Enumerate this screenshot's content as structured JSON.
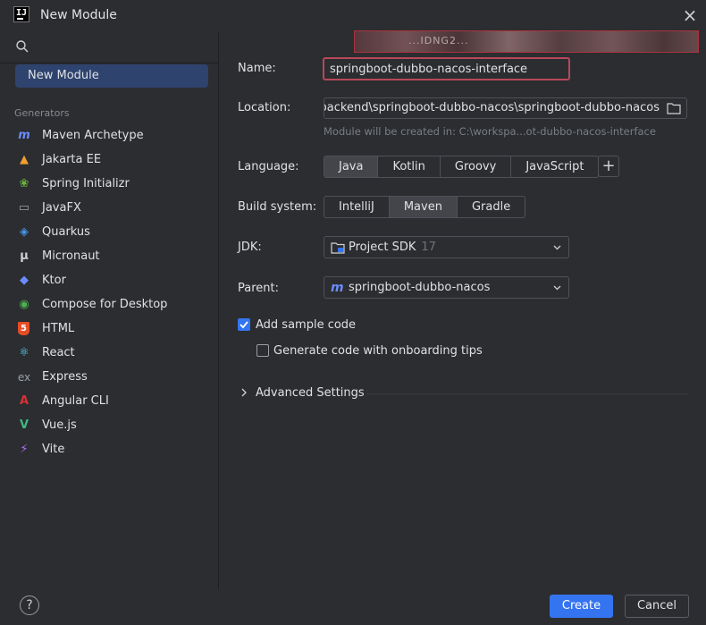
{
  "window": {
    "title": "New Module"
  },
  "sidebar": {
    "search_placeholder": "",
    "selected": "New Module",
    "group_label": "Generators",
    "generators": [
      {
        "label": "Maven Archetype",
        "icon": "maven-icon",
        "color": "#6b8cff"
      },
      {
        "label": "Jakarta EE",
        "icon": "jakarta-icon",
        "color": "#f0a030"
      },
      {
        "label": "Spring Initializr",
        "icon": "spring-icon",
        "color": "#6cb33f"
      },
      {
        "label": "JavaFX",
        "icon": "javafx-icon",
        "color": "#9aa0a6"
      },
      {
        "label": "Quarkus",
        "icon": "quarkus-icon",
        "color": "#4695eb"
      },
      {
        "label": "Micronaut",
        "icon": "micronaut-icon",
        "color": "#cfd1d4"
      },
      {
        "label": "Ktor",
        "icon": "ktor-icon",
        "color": "#6b8cff"
      },
      {
        "label": "Compose for Desktop",
        "icon": "compose-icon",
        "color": "#4caf50"
      },
      {
        "label": "HTML",
        "icon": "html-icon",
        "color": "#e44d26"
      },
      {
        "label": "React",
        "icon": "react-icon",
        "color": "#61dafb"
      },
      {
        "label": "Express",
        "icon": "express-icon",
        "color": "#9aa0a6"
      },
      {
        "label": "Angular CLI",
        "icon": "angular-icon",
        "color": "#dd3035"
      },
      {
        "label": "Vue.js",
        "icon": "vue-icon",
        "color": "#41b883"
      },
      {
        "label": "Vite",
        "icon": "vite-icon",
        "color": "#b46cff"
      }
    ]
  },
  "form": {
    "name_label": "Name:",
    "name_value": "springboot-dubbo-nacos-interface",
    "location_label": "Location:",
    "location_value": "backend\\springboot-dubbo-nacos\\springboot-dubbo-nacos",
    "location_hint": "Module will be created in: C:\\workspa...ot-dubbo-nacos-interface",
    "language_label": "Language:",
    "languages": [
      "Java",
      "Kotlin",
      "Groovy",
      "JavaScript"
    ],
    "language_selected": "Java",
    "build_label": "Build system:",
    "build_systems": [
      "IntelliJ",
      "Maven",
      "Gradle"
    ],
    "build_selected": "Maven",
    "jdk_label": "JDK:",
    "jdk_value": "Project SDK",
    "jdk_version": "17",
    "parent_label": "Parent:",
    "parent_value": "springboot-dubbo-nacos",
    "add_sample_code": "Add sample code",
    "add_sample_checked": true,
    "onboarding_tips": "Generate code with onboarding tips",
    "onboarding_checked": false,
    "advanced_settings": "Advanced Settings",
    "blurred_text": "...IDNG2..."
  },
  "footer": {
    "help": "?",
    "create": "Create",
    "cancel": "Cancel"
  },
  "colors": {
    "accent": "#3574f0",
    "background": "#2b2d30",
    "highlight_border": "#b8485a"
  }
}
